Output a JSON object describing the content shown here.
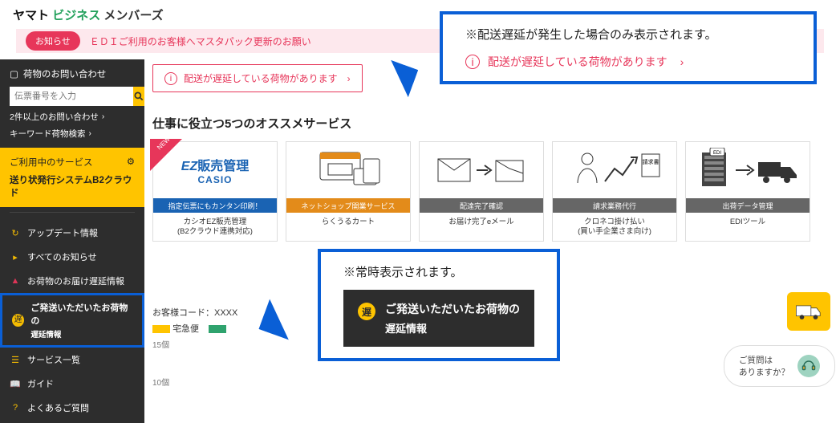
{
  "header": {
    "logo_part1": "ヤマト",
    "logo_part2": "ビジネス",
    "logo_part3": "メンバーズ"
  },
  "notice": {
    "pill": "お知らせ",
    "text": "ＥＤＩご利用のお客様へマスタパック更新のお願い"
  },
  "sidebar": {
    "search_title": "荷物のお問い合わせ",
    "search_placeholder": "伝票番号を入力",
    "multi_query": "2件以上のお問い合わせ",
    "keyword_search": "キーワード荷物検索",
    "svc_title": "ご利用中のサービス",
    "svc_line": "送り状発行システムB2クラウド",
    "nav": [
      {
        "icon": "↻",
        "label": "アップデート情報"
      },
      {
        "icon": "▸",
        "label": "すべてのお知らせ"
      },
      {
        "icon": "▲",
        "label": "お荷物のお届け遅延情報",
        "variant": "alert"
      },
      {
        "icon": "遅",
        "label": "ご発送いただいたお荷物の",
        "sub": "遅延情報",
        "variant": "highlight"
      },
      {
        "icon": "☰",
        "label": "サービス一覧"
      },
      {
        "icon": "📖",
        "label": "ガイド"
      },
      {
        "icon": "?",
        "label": "よくあるご質問"
      }
    ]
  },
  "content": {
    "delay_banner": "配送が遅延している荷物があります",
    "section_title": "仕事に役立つ5つのオススメサービス",
    "cards": [
      {
        "band_class": "blue",
        "band": "指定伝票にもカンタン印刷！",
        "title_top": "EZ販売管理",
        "title_sub": "CASIO",
        "cap1": "カシオEZ販売管理",
        "cap2": "(B2クラウド連携対応)",
        "ribbon": "NEW"
      },
      {
        "band_class": "orange",
        "band": "ネットショップ開業サービス",
        "title_top": "らくうるカート",
        "cap1": "らくうるカート",
        "cap2": ""
      },
      {
        "band_class": "gray",
        "band": "配達完了確認",
        "cap1": "お届け完了eメール",
        "cap2": ""
      },
      {
        "band_class": "gray",
        "band": "請求業務代行",
        "cap1": "クロネコ掛け払い",
        "cap2": "(買い手企業さま向け)"
      },
      {
        "band_class": "gray",
        "band": "出荷データ管理",
        "title_top": "EDI",
        "cap1": "EDIツール",
        "cap2": ""
      }
    ],
    "chart": {
      "customer_code": "お客様コード：XXXX",
      "legend1": "宅急便",
      "y15": "15個",
      "y10": "10個"
    }
  },
  "callouts": {
    "top_note": "※配送遅延が発生した場合のみ表示されます。",
    "top_sample": "配送が遅延している荷物があります",
    "mid_note": "※常時表示されます。",
    "mid_line1": "ご発送いただいたお荷物の",
    "mid_line2": "遅延情報"
  },
  "floats": {
    "help_text1": "ご質問は",
    "help_text2": "ありますか？"
  }
}
